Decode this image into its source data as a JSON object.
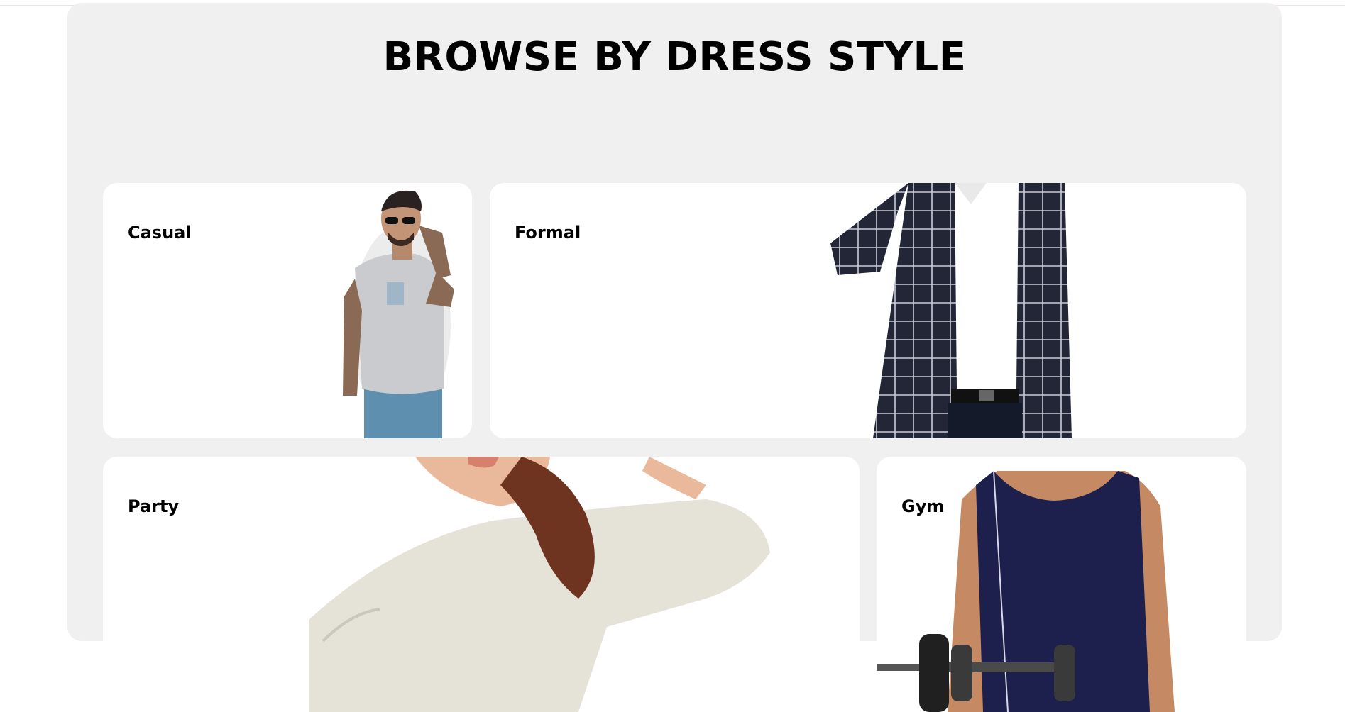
{
  "section": {
    "title": "BROWSE BY DRESS STYLE"
  },
  "styles": [
    {
      "label": "Casual"
    },
    {
      "label": "Formal"
    },
    {
      "label": "Party"
    },
    {
      "label": "Gym"
    }
  ]
}
